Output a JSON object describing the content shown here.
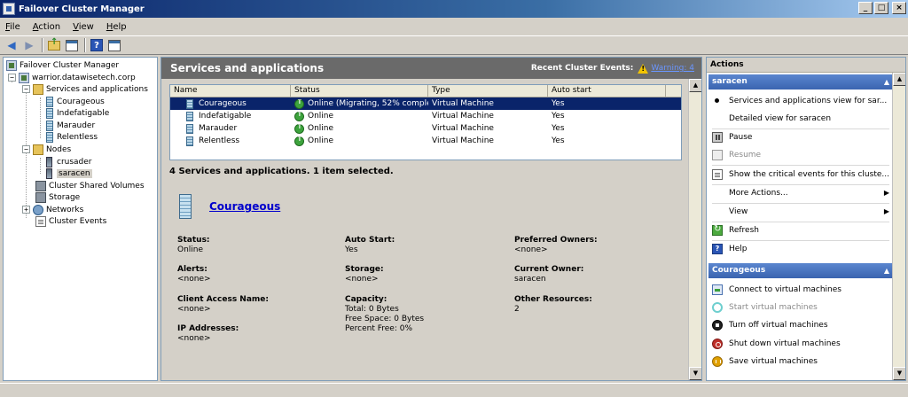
{
  "window": {
    "title": "Failover Cluster Manager"
  },
  "menu": [
    {
      "prefix": "",
      "accel": "F",
      "rest": "ile"
    },
    {
      "prefix": "",
      "accel": "A",
      "rest": "ction"
    },
    {
      "prefix": "",
      "accel": "V",
      "rest": "iew"
    },
    {
      "prefix": "",
      "accel": "H",
      "rest": "elp"
    }
  ],
  "tree": {
    "root": "Failover Cluster Manager",
    "cluster": "warrior.datawisetech.corp",
    "services": "Services and applications",
    "vms": [
      "Courageous",
      "Indefatigable",
      "Marauder",
      "Relentless"
    ],
    "nodes_label": "Nodes",
    "nodes": [
      "crusader",
      "saracen"
    ],
    "csv": "Cluster Shared Volumes",
    "storage": "Storage",
    "networks": "Networks",
    "events": "Cluster Events"
  },
  "center": {
    "title": "Services and applications",
    "recent_label": "Recent Cluster Events:",
    "recent_link": "Warning: 4",
    "columns": [
      "Name",
      "Status",
      "Type",
      "Auto start"
    ],
    "rows": [
      {
        "name": "Courageous",
        "status": "Online (Migrating, 52% complet...",
        "type": "Virtual Machine",
        "auto": "Yes"
      },
      {
        "name": "Indefatigable",
        "status": "Online",
        "type": "Virtual Machine",
        "auto": "Yes"
      },
      {
        "name": "Marauder",
        "status": "Online",
        "type": "Virtual Machine",
        "auto": "Yes"
      },
      {
        "name": "Relentless",
        "status": "Online",
        "type": "Virtual Machine",
        "auto": "Yes"
      }
    ],
    "summary": "4 Services and applications. 1 item selected.",
    "detail_name": "Courageous",
    "props": {
      "status_label": "Status:",
      "status_value": "Online",
      "autostart_label": "Auto Start:",
      "autostart_value": "Yes",
      "preferred_label": "Preferred Owners:",
      "preferred_value": "<none>",
      "alerts_label": "Alerts:",
      "alerts_value": "<none>",
      "storage_label": "Storage:",
      "storage_value": "<none>",
      "owner_label": "Current Owner:",
      "owner_value": "saracen",
      "can_label": "Client Access Name:",
      "can_value": "<none>",
      "capacity_label": "Capacity:",
      "capacity_total": "Total: 0 Bytes",
      "capacity_free": "Free Space: 0 Bytes",
      "capacity_pct": "Percent Free: 0%",
      "other_label": "Other Resources:",
      "other_value": "2",
      "ip_label": "IP Addresses:",
      "ip_value": "<none>"
    }
  },
  "actions": {
    "header": "Actions",
    "section1": "saracen",
    "items1": [
      "Services and applications view for sar...",
      "Detailed view for saracen",
      "Pause",
      "Resume",
      "Show the critical events for this cluste...",
      "More Actions...",
      "View",
      "Refresh",
      "Help"
    ],
    "section2": "Courageous",
    "items2": [
      "Connect to virtual machines",
      "Start virtual machines",
      "Turn off virtual machines",
      "Shut down virtual machines",
      "Save virtual machines"
    ]
  }
}
